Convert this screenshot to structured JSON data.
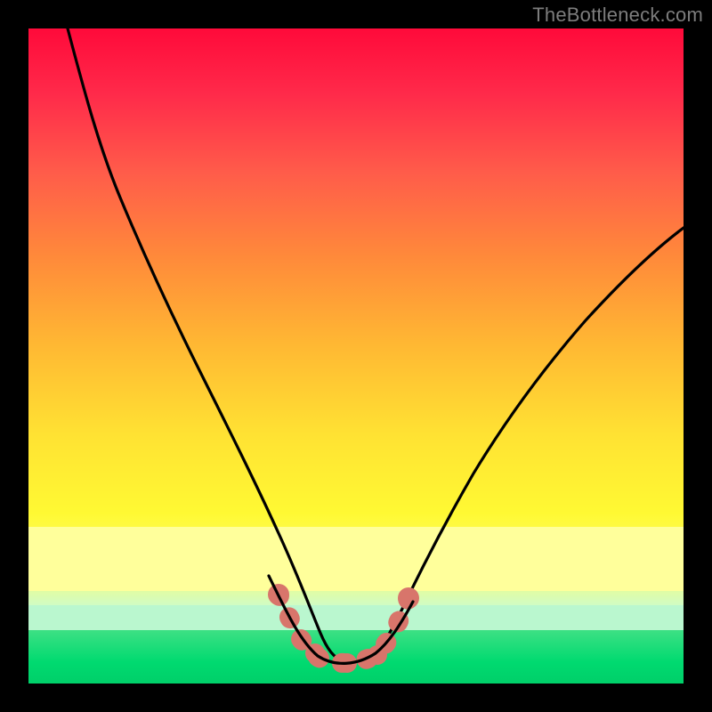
{
  "watermark": "TheBottleneck.com",
  "colors": {
    "background": "#000000",
    "curve": "#000000",
    "salmon": "#d8756b",
    "gradient_top": "#ff0a3a",
    "gradient_bottom": "#00cf69"
  },
  "chart_data": {
    "type": "line",
    "title": "",
    "xlabel": "",
    "ylabel": "",
    "xlim": [
      0,
      100
    ],
    "ylim": [
      0,
      100
    ],
    "grid": false,
    "series": [
      {
        "name": "bottleneck-curve",
        "x": [
          6,
          10,
          14,
          18,
          22,
          26,
          30,
          34,
          38,
          40,
          42,
          44,
          46,
          48,
          50,
          52,
          56,
          60,
          64,
          68,
          72,
          76,
          80,
          84,
          88,
          92,
          96,
          100
        ],
        "y": [
          100,
          86,
          74,
          63,
          52,
          42,
          33,
          25,
          17,
          13,
          9,
          6,
          4,
          3,
          3,
          3,
          6,
          11,
          18,
          25,
          32,
          39,
          45,
          51,
          56,
          61,
          65,
          68
        ]
      }
    ],
    "highlight_region": {
      "name": "salmon-dots",
      "points": [
        {
          "x": 38.5,
          "y": 12
        },
        {
          "x": 40,
          "y": 8
        },
        {
          "x": 42,
          "y": 5
        },
        {
          "x": 44,
          "y": 3.5
        },
        {
          "x": 46,
          "y": 3
        },
        {
          "x": 48,
          "y": 3
        },
        {
          "x": 50,
          "y": 3
        },
        {
          "x": 51.5,
          "y": 3.5
        },
        {
          "x": 53,
          "y": 5
        },
        {
          "x": 54.5,
          "y": 8
        },
        {
          "x": 56,
          "y": 11
        }
      ]
    }
  }
}
